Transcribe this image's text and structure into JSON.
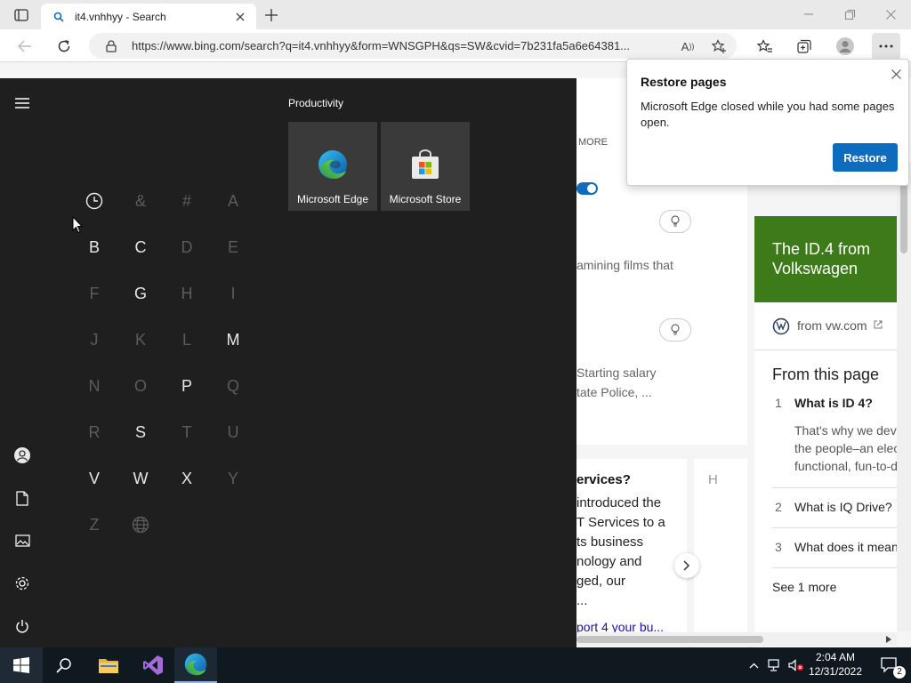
{
  "browser": {
    "tab_title": "it4.vnhhyy - Search",
    "url": "https://www.bing.com/search?q=it4.vnhhyy&form=WNSGPH&qs=SW&cvid=7b231fa5a6e64381..."
  },
  "page": {
    "tab_more": "MORE",
    "snippet1": "amining films that",
    "snippet2a": "Starting salary",
    "snippet2b": "tate Police, ...",
    "card_title": "ervices?",
    "card_lines": [
      "introduced the",
      "T Services to a",
      "ts business",
      "nology and",
      "ged, our",
      "..."
    ],
    "card_link": "port 4 your bu...",
    "sidebar": {
      "headline": "The ID.4 from Volkswagen",
      "source": "from vw.com",
      "section": "From this page",
      "faq": [
        {
          "num": "1",
          "q": "What is ID 4?",
          "a": [
            "That's why we deve",
            "the people–an elec",
            "functional, fun-to-d"
          ]
        },
        {
          "num": "2",
          "q": "What is IQ Drive?"
        },
        {
          "num": "3",
          "q": "What does it mean"
        }
      ],
      "see_more": "See 1 more"
    }
  },
  "restore_popup": {
    "title": "Restore pages",
    "body": "Microsoft Edge closed while you had some pages open.",
    "button": "Restore"
  },
  "start_menu": {
    "group_title": "Productivity",
    "tiles": [
      {
        "label": "Microsoft Edge",
        "icon": "edge-icon"
      },
      {
        "label": "Microsoft Store",
        "icon": "store-icon"
      }
    ],
    "letters": [
      {
        "ch": "clock",
        "active": true
      },
      {
        "ch": "&",
        "active": false
      },
      {
        "ch": "#",
        "active": false
      },
      {
        "ch": "A",
        "active": false
      },
      {
        "ch": "B",
        "active": true
      },
      {
        "ch": "C",
        "active": true
      },
      {
        "ch": "D",
        "active": false
      },
      {
        "ch": "E",
        "active": false
      },
      {
        "ch": "F",
        "active": false
      },
      {
        "ch": "G",
        "active": true
      },
      {
        "ch": "H",
        "active": false
      },
      {
        "ch": "I",
        "active": false
      },
      {
        "ch": "J",
        "active": false
      },
      {
        "ch": "K",
        "active": false
      },
      {
        "ch": "L",
        "active": false
      },
      {
        "ch": "M",
        "active": true
      },
      {
        "ch": "N",
        "active": false
      },
      {
        "ch": "O",
        "active": false
      },
      {
        "ch": "P",
        "active": true
      },
      {
        "ch": "Q",
        "active": false
      },
      {
        "ch": "R",
        "active": false
      },
      {
        "ch": "S",
        "active": true
      },
      {
        "ch": "T",
        "active": false
      },
      {
        "ch": "U",
        "active": false
      },
      {
        "ch": "V",
        "active": true
      },
      {
        "ch": "W",
        "active": true
      },
      {
        "ch": "X",
        "active": true
      },
      {
        "ch": "Y",
        "active": false
      },
      {
        "ch": "Z",
        "active": false
      },
      {
        "ch": "globe",
        "active": false
      }
    ]
  },
  "taskbar": {
    "time": "2:04 AM",
    "date": "12/31/2022",
    "notification_count": "2"
  },
  "colors": {
    "start_bg": "#1f1f1f",
    "taskbar_bg": "#101820",
    "accent_blue": "#0f6cbd",
    "vw_green": "#3d7a19"
  }
}
